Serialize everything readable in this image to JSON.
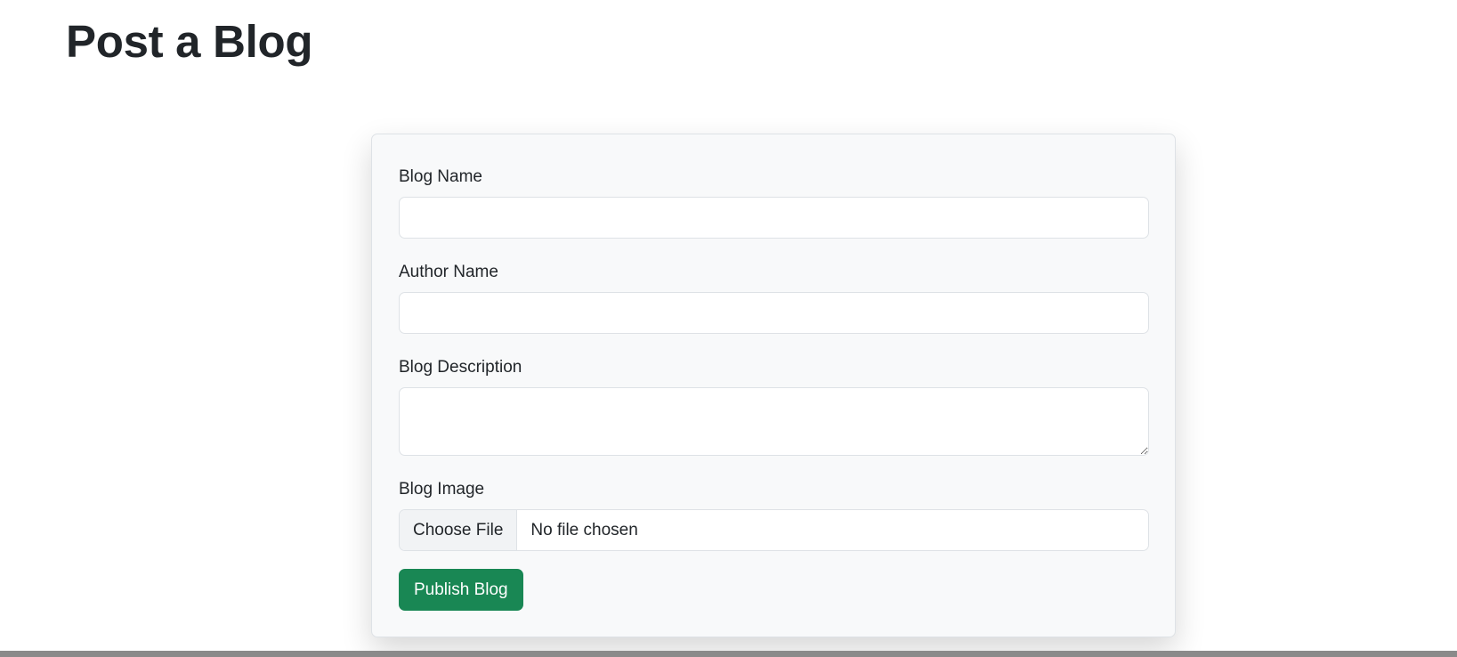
{
  "page": {
    "title": "Post a Blog"
  },
  "form": {
    "blog_name": {
      "label": "Blog Name",
      "value": "",
      "placeholder": ""
    },
    "author_name": {
      "label": "Author Name",
      "value": "",
      "placeholder": ""
    },
    "blog_description": {
      "label": "Blog Description",
      "value": "",
      "placeholder": ""
    },
    "blog_image": {
      "label": "Blog Image",
      "button_label": "Choose File",
      "status": "No file chosen"
    },
    "submit_label": "Publish Blog"
  },
  "colors": {
    "primary_button": "#198754",
    "card_background": "#f8f9fa",
    "border": "#dee2e6",
    "text": "#212529"
  }
}
